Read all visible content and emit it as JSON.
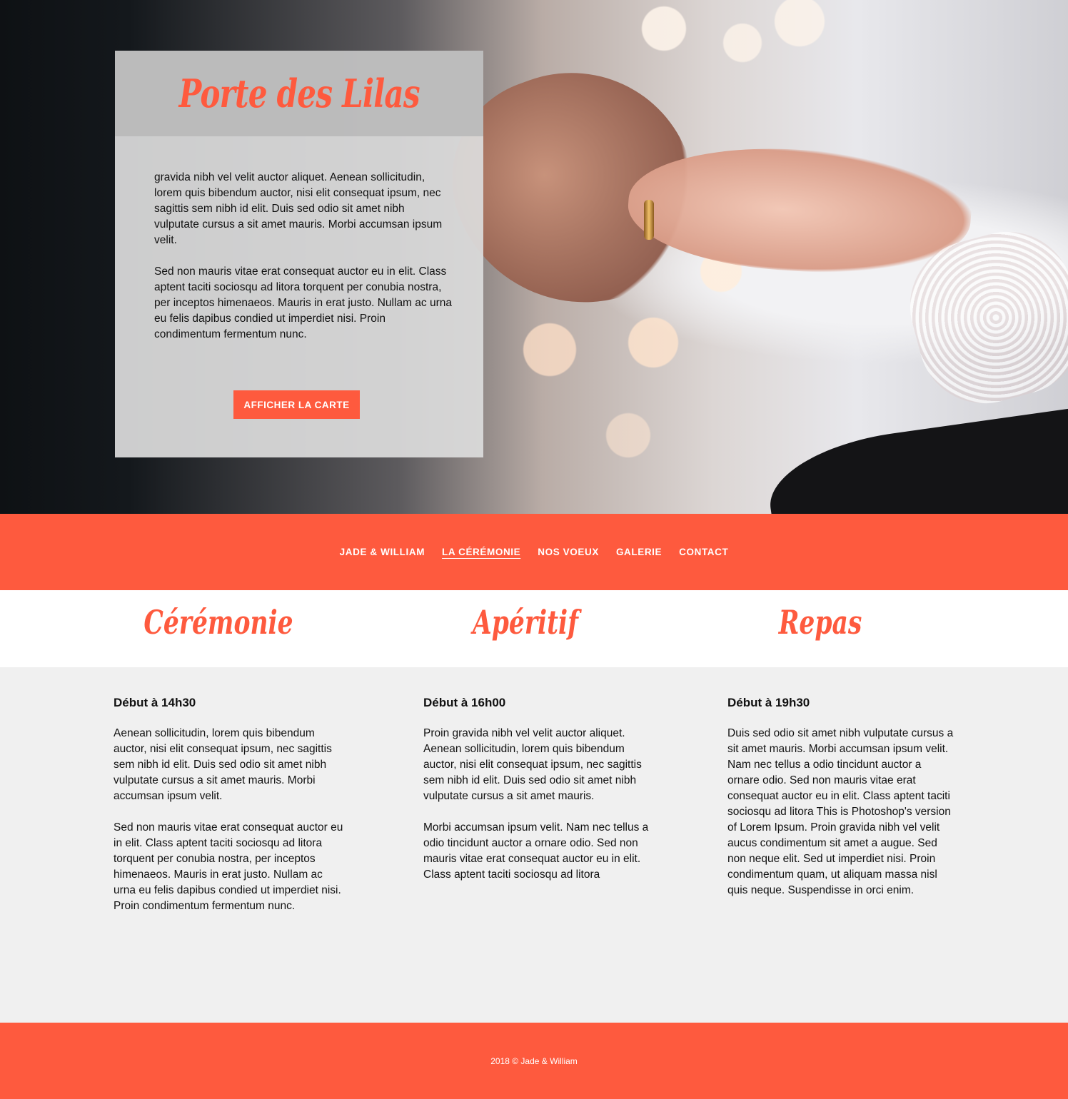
{
  "hero": {
    "title": "Porte des Lilas",
    "paragraphs": [
      "gravida nibh vel velit auctor aliquet. Aenean sollicitudin, lorem quis bibendum auctor, nisi elit consequat ipsum, nec sagittis sem nibh id elit. Duis sed odio sit amet nibh vulputate cursus a sit amet mauris. Morbi accumsan ipsum velit.",
      "Sed non  mauris vitae erat consequat auctor eu in elit. Class aptent taciti sociosqu ad litora torquent per conubia nostra, per inceptos himenaeos. Mauris in erat justo. Nullam ac urna eu felis dapibus condied ut imperdiet nisi. Proin condimentum fermentum nunc."
    ],
    "button_label": "AFFICHER LA CARTE"
  },
  "nav": {
    "items": [
      {
        "label": "JADE & WILLIAM"
      },
      {
        "label": "LA CÉRÉMONIE"
      },
      {
        "label": "NOS VOEUX"
      },
      {
        "label": "GALERIE"
      },
      {
        "label": "CONTACT"
      }
    ],
    "active_index": 1
  },
  "columns": [
    {
      "title": "Cérémonie",
      "subtitle": "Début à 14h30",
      "paragraphs": [
        "Aenean sollicitudin, lorem quis bibendum auctor, nisi elit consequat ipsum, nec sagittis sem nibh id elit. Duis sed odio sit amet nibh vulputate cursus a sit amet mauris. Morbi accumsan ipsum velit.",
        "Sed non  mauris vitae erat consequat auctor eu in elit. Class aptent taciti sociosqu ad litora torquent per conubia nostra, per inceptos himenaeos. Mauris in erat justo. Nullam ac urna eu felis dapibus condied ut imperdiet nisi. Proin condimentum fermentum nunc."
      ]
    },
    {
      "title": "Apéritif",
      "subtitle": "Début à 16h00",
      "paragraphs": [
        "Proin gravida nibh vel velit auctor aliquet. Aenean sollicitudin, lorem quis bibendum auctor, nisi elit consequat ipsum, nec sagittis sem nibh id elit. Duis sed odio sit amet nibh vulputate cursus a sit amet mauris.",
        "Morbi accumsan ipsum velit. Nam nec tellus a odio tincidunt auctor a ornare odio. Sed non  mauris vitae erat consequat auctor eu in elit. Class aptent taciti sociosqu ad litora"
      ]
    },
    {
      "title": "Repas",
      "subtitle": "Début à 19h30",
      "paragraphs": [
        "Duis sed odio sit amet nibh vulputate cursus a sit amet mauris. Morbi accumsan ipsum velit. Nam nec tellus a odio tincidunt auctor a ornare odio. Sed non  mauris vitae erat consequat auctor eu in elit. Class aptent taciti sociosqu ad litora This is Photoshop's version  of Lorem Ipsum. Proin gravida nibh vel velit aucus condimentum sit amet a augue. Sed non neque elit. Sed ut imperdiet nisi. Proin condimentum quam, ut aliquam massa nisl quis neque. Suspendisse in orci enim."
      ]
    }
  ],
  "footer": {
    "text": "2018 © Jade & William"
  },
  "colors": {
    "accent": "#fe5a3e",
    "content_bg": "#f0f0f0",
    "card_bg": "#dcdcdc"
  },
  "icons": [
    "wedding-photo"
  ]
}
